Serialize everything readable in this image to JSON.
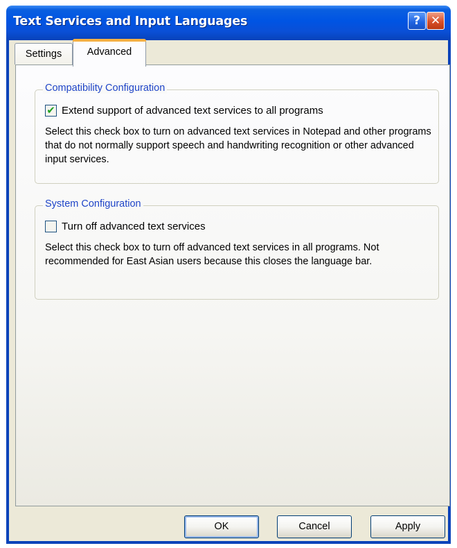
{
  "window": {
    "title": "Text Services and Input Languages",
    "help_symbol": "?",
    "close_symbol": "✕"
  },
  "tabs": [
    {
      "label": "Settings",
      "selected": false
    },
    {
      "label": "Advanced",
      "selected": true
    }
  ],
  "compatibility": {
    "legend": "Compatibility Configuration",
    "checkbox_label": "Extend support of advanced text services to all programs",
    "checked": true,
    "check_glyph": "✔",
    "description": "Select this check box to turn on advanced text services in Notepad and other programs that do not normally support speech and handwriting recognition or other advanced input services."
  },
  "system": {
    "legend": "System Configuration",
    "checkbox_label": "Turn off advanced text services",
    "checked": false,
    "check_glyph": "",
    "description": "Select this check box to turn off advanced text services in all programs. Not recommended for East Asian users because this closes the language bar."
  },
  "buttons": {
    "ok": "OK",
    "cancel": "Cancel",
    "apply": "Apply"
  },
  "colors": {
    "titlebar": "#0054e3",
    "legend_text": "#1f45c8",
    "selected_tab_accent": "#f5b042",
    "check_mark": "#21a121",
    "close_button": "#d8502a"
  }
}
